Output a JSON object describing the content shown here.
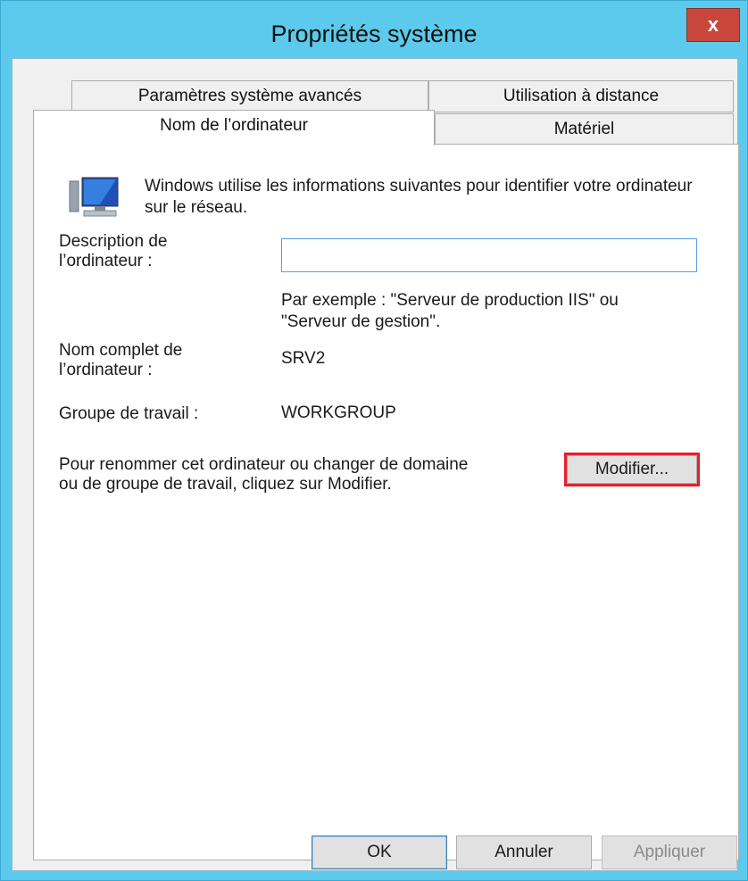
{
  "window": {
    "title": "Propriétés système",
    "close_label": "x"
  },
  "tabs": {
    "row1": [
      {
        "label": "Paramètres système avancés"
      },
      {
        "label": "Utilisation à distance"
      }
    ],
    "row2": [
      {
        "label": "Nom de l’ordinateur",
        "active": true
      },
      {
        "label": "Matériel"
      }
    ]
  },
  "panel": {
    "intro": "Windows utilise les informations suivantes pour identifier votre ordinateur sur le réseau.",
    "description_label_line1": "Description de",
    "description_label_line2": "l’ordinateur :",
    "description_value": "",
    "description_hint_line1": "Par exemple : \"Serveur de production IIS\" ou",
    "description_hint_line2": "\"Serveur de gestion\".",
    "fullname_label_line1": "Nom complet de",
    "fullname_label_line2": "l’ordinateur :",
    "fullname_value": "SRV2",
    "workgroup_label": "Groupe de travail :",
    "workgroup_value": "WORKGROUP",
    "rename_text_line1": "Pour renommer cet ordinateur ou changer de domaine",
    "rename_text_line2": "ou de groupe de travail, cliquez sur Modifier.",
    "modify_label": "Modifier..."
  },
  "footer": {
    "ok_label": "OK",
    "cancel_label": "Annuler",
    "apply_label": "Appliquer"
  },
  "colors": {
    "title_bar": "#5ccaec",
    "close": "#c9463d",
    "highlight": "#e5202b"
  },
  "icons": {
    "computer": "computer-icon"
  }
}
